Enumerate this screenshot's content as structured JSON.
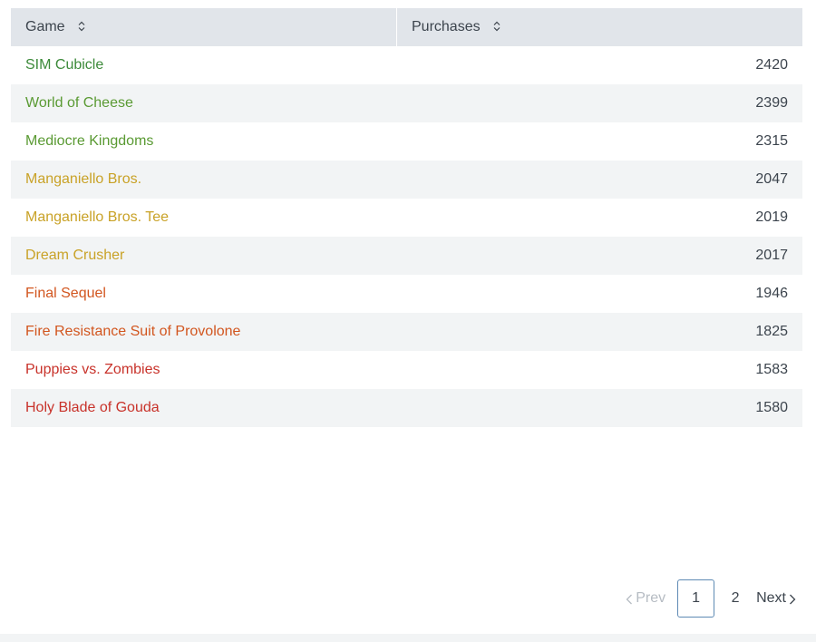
{
  "table": {
    "headers": {
      "game": "Game",
      "purchases": "Purchases"
    },
    "rows": [
      {
        "game": "SIM Cubicle",
        "purchases": "2420",
        "color": "#3c8a3a"
      },
      {
        "game": "World of Cheese",
        "purchases": "2399",
        "color": "#5a9a33"
      },
      {
        "game": "Mediocre Kingdoms",
        "purchases": "2315",
        "color": "#5a9a33"
      },
      {
        "game": "Manganiello Bros.",
        "purchases": "2047",
        "color": "#c9a227"
      },
      {
        "game": "Manganiello Bros. Tee",
        "purchases": "2019",
        "color": "#c9a227"
      },
      {
        "game": "Dream Crusher",
        "purchases": "2017",
        "color": "#c9a227"
      },
      {
        "game": "Final Sequel",
        "purchases": "1946",
        "color": "#d2561f"
      },
      {
        "game": "Fire Resistance Suit of Provolone",
        "purchases": "1825",
        "color": "#d2561f"
      },
      {
        "game": "Puppies vs. Zombies",
        "purchases": "1583",
        "color": "#c8322a"
      },
      {
        "game": "Holy Blade of Gouda",
        "purchases": "1580",
        "color": "#c8322a"
      }
    ]
  },
  "pagination": {
    "prev_label": "Prev",
    "pages": [
      "1",
      "2"
    ],
    "current": "1",
    "next_label": "Next"
  },
  "icons": {
    "sort": "sort-icon",
    "prev": "chevron-left-icon",
    "next": "chevron-right-icon"
  }
}
